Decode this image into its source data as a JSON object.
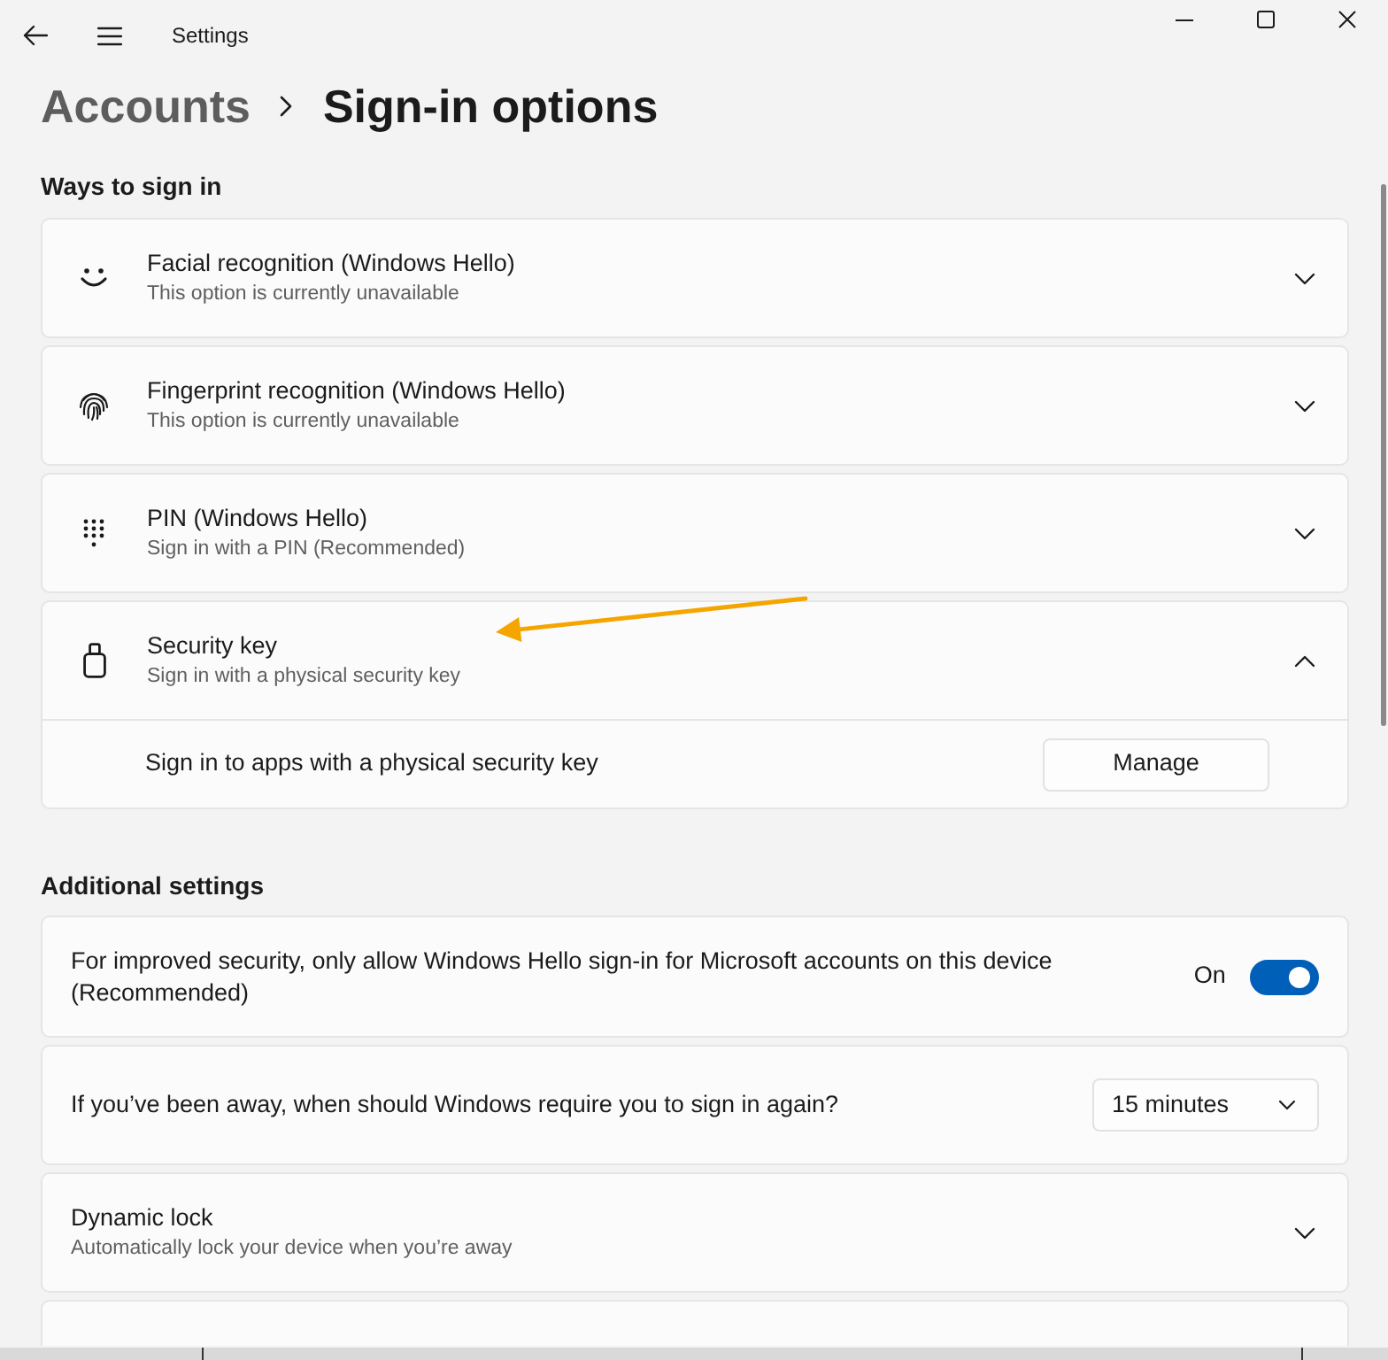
{
  "window": {
    "title": "Settings"
  },
  "breadcrumb": [
    {
      "label": "Accounts",
      "current": false
    },
    {
      "label": "Sign-in options",
      "current": true
    }
  ],
  "sections": [
    {
      "heading": "Ways to sign in",
      "items": [
        {
          "kind": "expander",
          "title": "Facial recognition (Windows Hello)",
          "subtitle": "This option is currently unavailable",
          "expanded": false
        },
        {
          "kind": "expander",
          "title": "Fingerprint recognition (Windows Hello)",
          "subtitle": "This option is currently unavailable",
          "expanded": false
        },
        {
          "kind": "expander",
          "title": "PIN (Windows Hello)",
          "subtitle": "Sign in with a PIN (Recommended)",
          "expanded": false
        },
        {
          "kind": "expander",
          "title": "Security key",
          "subtitle": "Sign in with a physical security key",
          "expanded": true,
          "content": {
            "text": "Sign in to apps with a physical security key",
            "button": "Manage"
          }
        }
      ]
    },
    {
      "heading": "Additional settings",
      "items": [
        {
          "kind": "toggle",
          "text": "For improved security, only allow Windows Hello sign-in for Microsoft accounts on this device (Recommended)",
          "state_label": "On",
          "on": true
        },
        {
          "kind": "dropdown",
          "text": "If you’ve been away, when should Windows require you to sign in again?",
          "value": "15 minutes"
        },
        {
          "kind": "expander",
          "title": "Dynamic lock",
          "subtitle": "Automatically lock your device when you’re away",
          "expanded": false
        },
        {
          "kind": "cutoff"
        }
      ]
    }
  ],
  "annotations": [
    {
      "kind": "arrow"
    }
  ]
}
